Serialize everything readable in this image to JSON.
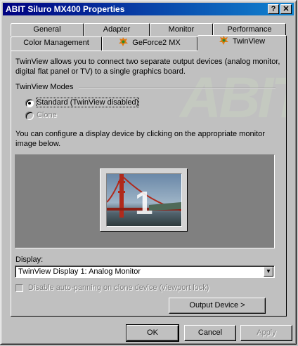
{
  "window": {
    "title": "ABIT Siluro MX400 Properties",
    "help_glyph": "?",
    "close_glyph": "✕"
  },
  "tabs_back": [
    "General",
    "Adapter",
    "Monitor",
    "Performance"
  ],
  "tabs_front": [
    "Color Management",
    "GeForce2 MX",
    "TwinView"
  ],
  "selected_tab": "TwinView",
  "panel": {
    "intro": "TwinView allows you to connect two separate output devices (analog monitor, digital flat panel or TV) to a single graphics board.",
    "modes_group": "TwinView Modes",
    "mode_standard": "Standard (TwinView disabled)",
    "mode_clone": "Clone",
    "selected_mode": "Standard (TwinView disabled)",
    "configure_text": "You can configure a display device by clicking on the appropriate monitor image below.",
    "monitor_number": "1",
    "display_label": "Display:",
    "display_value": "TwinView Display 1: Analog Monitor",
    "autopan_label": "Disable auto-panning on clone device (viewport lock)",
    "autopan_checked": false,
    "output_device_button": "Output Device >",
    "watermark": "ABIT"
  },
  "buttons": {
    "ok": "OK",
    "cancel": "Cancel",
    "apply": "Apply"
  },
  "colors": {
    "title_start": "#000080",
    "title_end": "#1084d0",
    "face": "#c0c0c0"
  }
}
